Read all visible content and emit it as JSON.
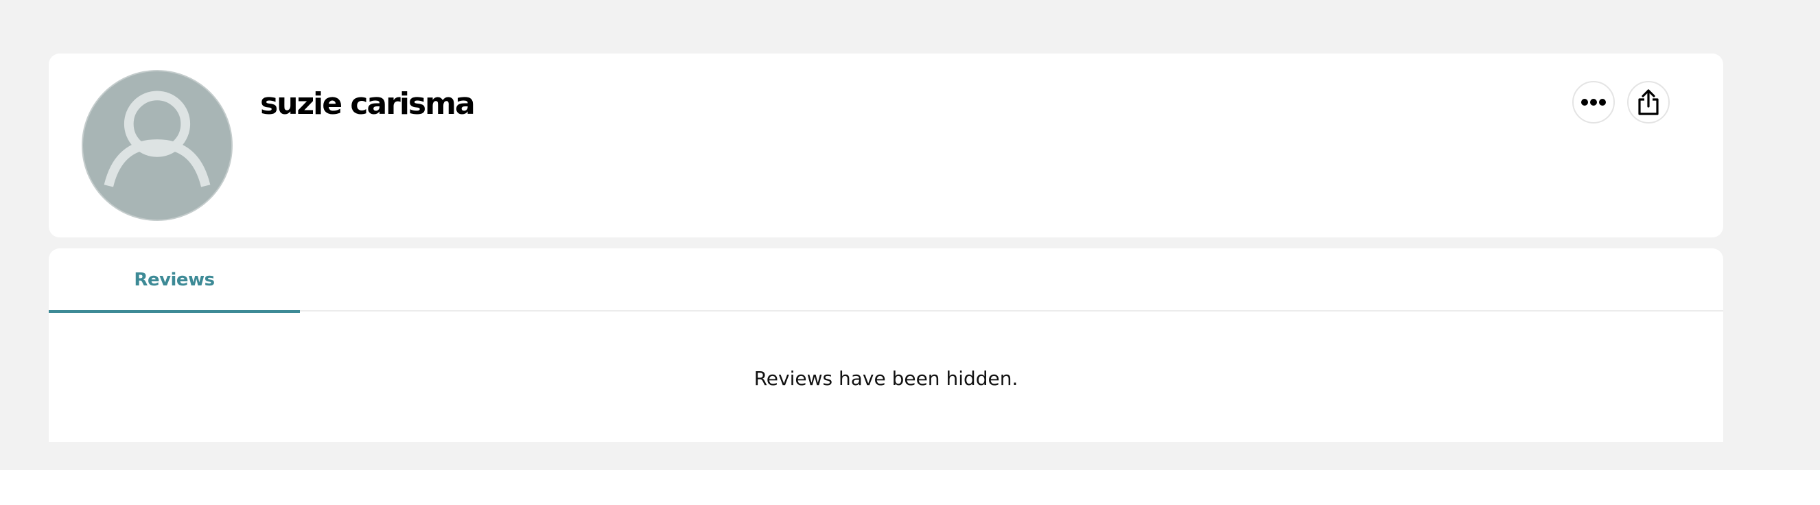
{
  "profile": {
    "name": "suzie carisma"
  },
  "actions": {
    "more_icon": "more-horizontal-icon",
    "share_icon": "share-icon"
  },
  "tabs": [
    {
      "label": "Reviews",
      "selected": true
    }
  ],
  "reviews": {
    "empty_message": "Reviews have been hidden."
  },
  "colors": {
    "accent": "#3d8a96",
    "avatar_bg": "#a8b5b5",
    "page_bg": "#f2f2f2"
  }
}
